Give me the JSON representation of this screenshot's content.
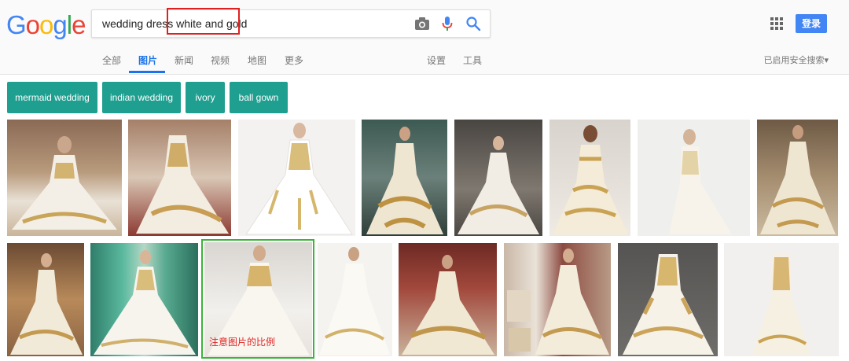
{
  "logo": {
    "letters": [
      "G",
      "o",
      "o",
      "g",
      "l",
      "e"
    ],
    "colors": [
      "#4285F4",
      "#EA4335",
      "#FBBC05",
      "#4285F4",
      "#34A853",
      "#EA4335"
    ]
  },
  "search": {
    "query": "wedding dress white and gold"
  },
  "header": {
    "signin_label": "登录",
    "safe_search": "已启用安全搜索▾"
  },
  "tabs": [
    {
      "label": "全部"
    },
    {
      "label": "图片",
      "active": true
    },
    {
      "label": "新闻"
    },
    {
      "label": "视频"
    },
    {
      "label": "地图"
    },
    {
      "label": "更多"
    },
    {
      "label": "设置"
    },
    {
      "label": "工具"
    }
  ],
  "chips": [
    "mermaid wedding",
    "indian wedding",
    "ivory",
    "ball gown"
  ],
  "annotation": {
    "text": "注意图片的比例"
  },
  "colors": {
    "accent": "#1a73e8",
    "chip": "#1f9f8f",
    "signin": "#4285f4",
    "highlight": "#e02020",
    "annotation": "#3ab53a"
  }
}
